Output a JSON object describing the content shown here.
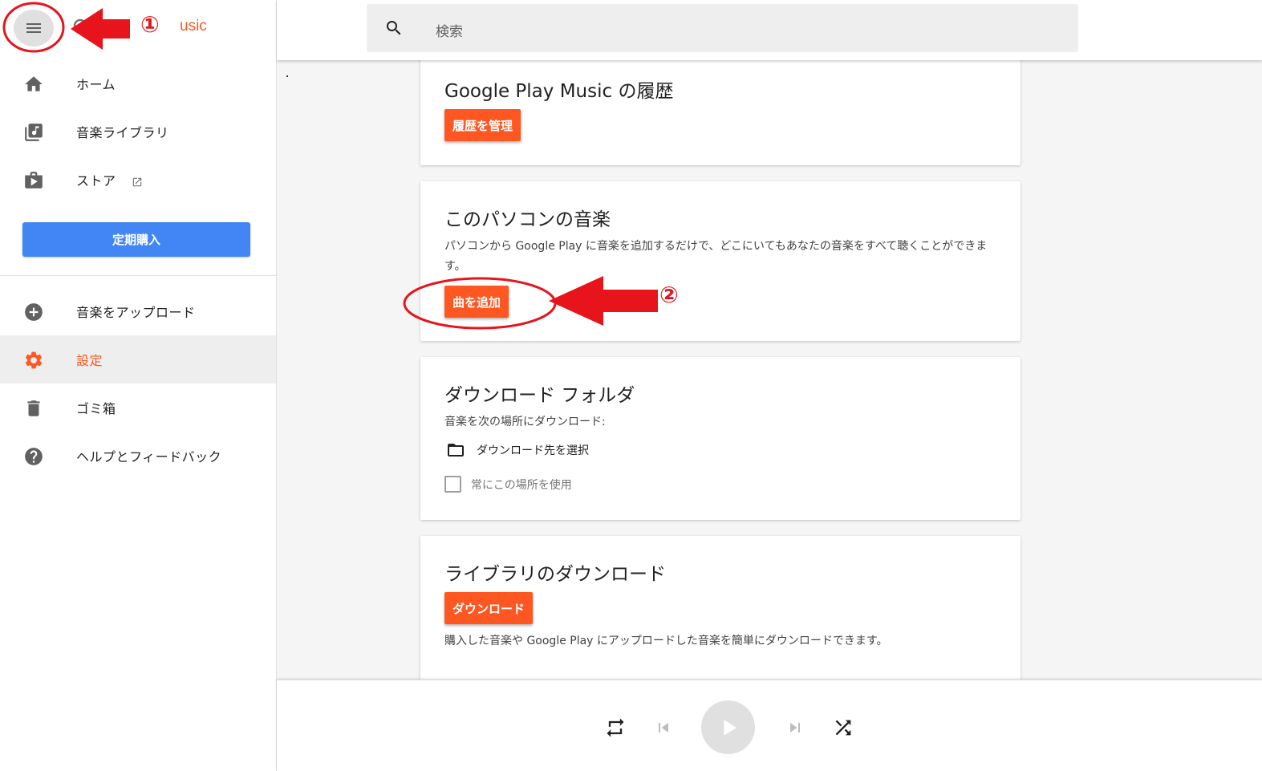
{
  "sidebar": {
    "brand_partial": "usic",
    "items": [
      {
        "label": "ホーム",
        "icon": "home-icon"
      },
      {
        "label": "音楽ライブラリ",
        "icon": "library-music-icon"
      },
      {
        "label": "ストア",
        "icon": "shop-icon",
        "external": true
      },
      {
        "label": "音楽をアップロード",
        "icon": "add-circle-icon"
      },
      {
        "label": "設定",
        "icon": "gear-icon",
        "active": true
      },
      {
        "label": "ゴミ箱",
        "icon": "trash-icon"
      },
      {
        "label": "ヘルプとフィードバック",
        "icon": "help-icon"
      }
    ],
    "subscribe_label": "定期購入"
  },
  "search": {
    "placeholder": "検索"
  },
  "cards": {
    "history": {
      "title": "Google Play Music の履歴",
      "button": "履歴を管理"
    },
    "computer_music": {
      "title": "このパソコンの音楽",
      "description": "パソコンから Google Play に音楽を追加するだけで、どこにいてもあなたの音楽をすべて聴くことができます。",
      "button": "曲を追加"
    },
    "download_folder": {
      "title": "ダウンロード フォルダ",
      "subtitle": "音楽を次の場所にダウンロード:",
      "folder_label": "ダウンロード先を選択",
      "checkbox_label": "常にこの場所を使用"
    },
    "library_download": {
      "title": "ライブラリのダウンロード",
      "button": "ダウンロード",
      "description": "購入した音楽や Google Play にアップロードした音楽を簡単にダウンロードできます。"
    }
  },
  "annotations": {
    "step1": "①",
    "step2": "②",
    "color": "#e8141c"
  },
  "colors": {
    "accent": "#ff5722",
    "subscribe": "#4285f4"
  }
}
